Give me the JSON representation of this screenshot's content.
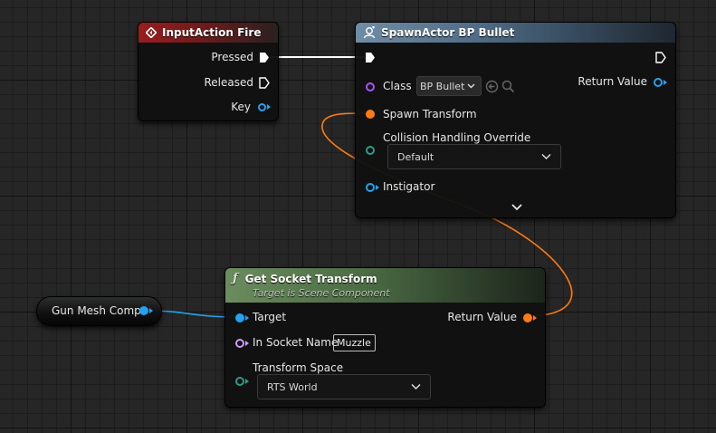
{
  "nodes": {
    "input_action": {
      "title": "InputAction Fire",
      "pins": {
        "pressed": "Pressed",
        "released": "Released",
        "key": "Key"
      }
    },
    "spawn_actor": {
      "title": "SpawnActor BP Bullet",
      "class_label": "Class",
      "class_value": "BP Bullet",
      "spawn_transform": "Spawn Transform",
      "collision_label": "Collision Handling Override",
      "collision_value": "Default",
      "instigator": "Instigator",
      "return_value": "Return Value"
    },
    "get_socket": {
      "title": "Get Socket Transform",
      "subtitle": "Target is Scene Component",
      "target": "Target",
      "socket_label": "In Socket Name",
      "socket_value": "Muzzle",
      "space_label": "Transform Space",
      "space_value": "RTS World",
      "return_value": "Return Value"
    },
    "gun_mesh": {
      "label": "Gun Mesh Comp"
    }
  },
  "colors": {
    "exec_wire": "#ffffff",
    "object_wire": "#22a3f0",
    "transform_wire": "#ff7a12",
    "event_header": "#9b1d1d",
    "spawn_header": "#6f8da6",
    "function_header": "#6a8c5e"
  },
  "icons": {
    "event": "diamond-event-icon",
    "spawn": "spawn-actor-icon",
    "function": "function-f-icon"
  }
}
